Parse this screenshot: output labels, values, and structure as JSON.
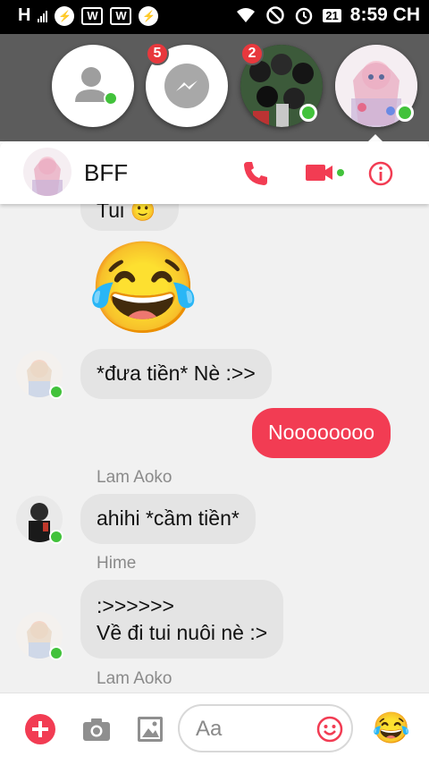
{
  "status_bar": {
    "network": "H",
    "battery": "21",
    "time": "8:59 CH"
  },
  "chat_heads": {
    "messenger_badge": "5",
    "group_badge": "2"
  },
  "header": {
    "title": "BFF"
  },
  "messages": [
    {
      "id": "partial",
      "text": "Tui 🙂"
    },
    {
      "id": "emoji",
      "text": "😂"
    },
    {
      "id": "m1",
      "text": "*đưa tiền* Nè :>>"
    },
    {
      "id": "m2",
      "text": "Noooooooo"
    },
    {
      "id": "m3",
      "text": "ahihi *cầm tiền*"
    },
    {
      "id": "m4_line1",
      "text": ":>>>>>>"
    },
    {
      "id": "m4_line2",
      "text": "Về đi tui nuôi nè :>"
    }
  ],
  "senders": {
    "s1": "Lam Aoko",
    "s2": "Hime",
    "s3": "Lam Aoko"
  },
  "composer": {
    "placeholder": "Aa",
    "quick_emoji": "😂"
  },
  "colors": {
    "accent": "#f23c53",
    "online": "#42c23b",
    "bubble_in": "#e4e4e4"
  }
}
